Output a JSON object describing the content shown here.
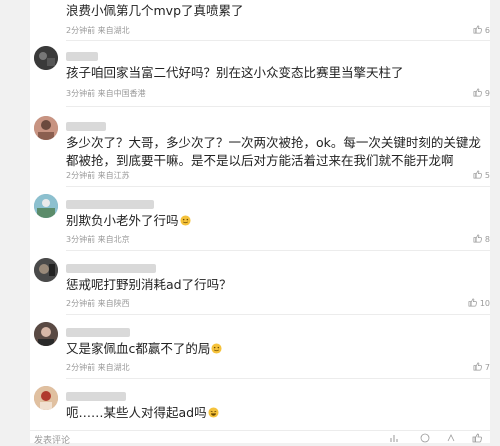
{
  "comments": [
    {
      "text": "浪费小佩第几个mvp了真喷累了",
      "time": "2分钟前",
      "location": "来自湖北",
      "likes": "6",
      "avatar_color": "#7b8a95"
    },
    {
      "text": "孩子咱回家当富二代好吗？别在这小众变态比赛里当擎天柱了",
      "time": "3分钟前",
      "location": "来自中国香港",
      "likes": "9",
      "avatar_color": "#2b2b2b"
    },
    {
      "text": "多少次了？大哥，多少次了？一次两次被抢，ok。每一次关键时刻的关键龙都被抢，到底要干嘛。是不是以后对方能活着过来在我们就不能开龙啊",
      "time": "2分钟前",
      "location": "来自江苏",
      "likes": "5",
      "avatar_color": "#b07a6a"
    },
    {
      "text": "别欺负小老外了行吗",
      "time": "3分钟前",
      "location": "来自北京",
      "likes": "8",
      "avatar_color": "#6aa0b8"
    },
    {
      "text": "惩戒呢打野别消耗ad了行吗？",
      "time": "2分钟前",
      "location": "来自陕西",
      "likes": "10",
      "avatar_color": "#3c3c3c"
    },
    {
      "text": "又是家佩血c都赢不了的局",
      "time": "2分钟前",
      "location": "来自湖北",
      "likes": "7",
      "avatar_color": "#4a3f3a"
    },
    {
      "text": "呃……某些人对得起ad吗",
      "time": "",
      "location": "",
      "likes": "",
      "avatar_color": "#c79b7a"
    }
  ],
  "composer": {
    "placeholder": "发表评论"
  },
  "icons": {
    "like": "thumbs-up-icon",
    "emoji": "emoji-icon",
    "share": "share-icon",
    "chart": "chart-icon"
  }
}
